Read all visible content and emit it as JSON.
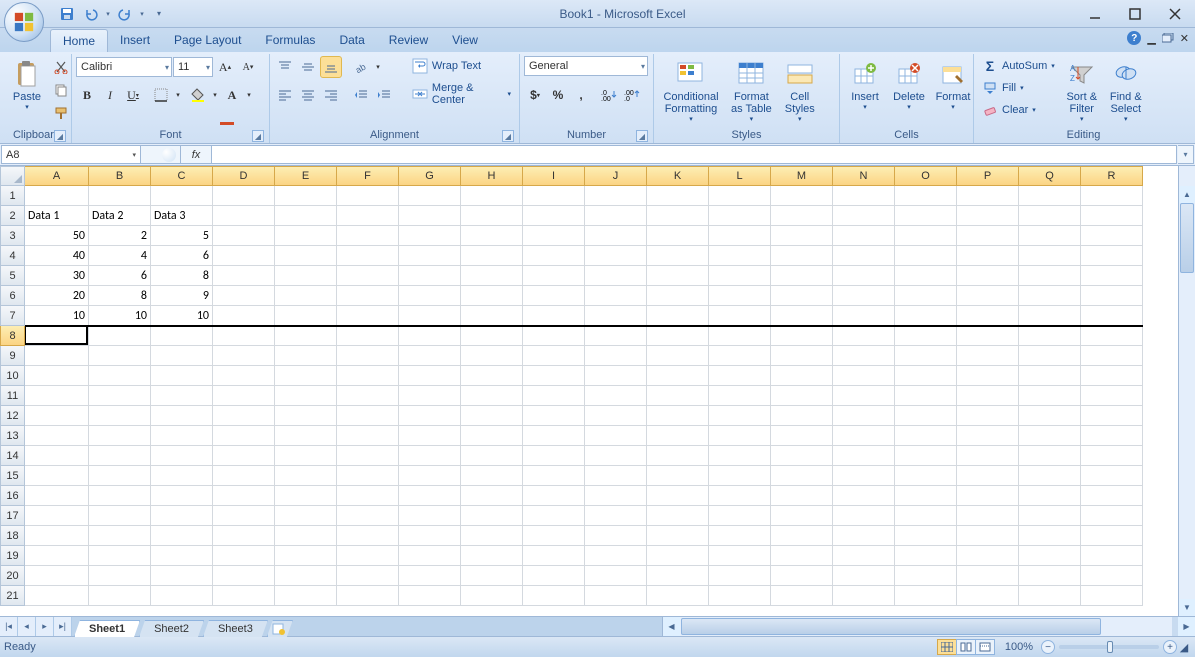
{
  "title": "Book1 - Microsoft Excel",
  "tabs": [
    "Home",
    "Insert",
    "Page Layout",
    "Formulas",
    "Data",
    "Review",
    "View"
  ],
  "active_tab": "Home",
  "ribbon": {
    "clipboard": {
      "label": "Clipboard",
      "paste": "Paste"
    },
    "font": {
      "label": "Font",
      "name": "Calibri",
      "size": "11"
    },
    "alignment": {
      "label": "Alignment",
      "wrap": "Wrap Text",
      "merge": "Merge & Center"
    },
    "number": {
      "label": "Number",
      "format": "General"
    },
    "styles": {
      "label": "Styles",
      "cond": "Conditional\nFormatting",
      "table": "Format\nas Table",
      "cell": "Cell\nStyles"
    },
    "cells": {
      "label": "Cells",
      "insert": "Insert",
      "delete": "Delete",
      "format": "Format"
    },
    "editing": {
      "label": "Editing",
      "autosum": "AutoSum",
      "fill": "Fill",
      "clear": "Clear",
      "sort": "Sort &\nFilter",
      "find": "Find &\nSelect"
    }
  },
  "namebox": "A8",
  "fx": "fx",
  "columns": [
    "A",
    "B",
    "C",
    "D",
    "E",
    "F",
    "G",
    "H",
    "I",
    "J",
    "K",
    "L",
    "M",
    "N",
    "O",
    "P",
    "Q",
    "R"
  ],
  "col_widths": {
    "default": 62,
    "first": 64
  },
  "rows_visible": 21,
  "highlighted_row": 8,
  "active_cell": {
    "col": 0,
    "row": 7
  },
  "cells": {
    "A2": "Data 1",
    "B2": "Data 2",
    "C2": "Data 3",
    "A3": "50",
    "B3": "2",
    "C3": "5",
    "A4": "40",
    "B4": "4",
    "C4": "6",
    "A5": "30",
    "B5": "6",
    "C5": "8",
    "A6": "20",
    "B6": "8",
    "C6": "9",
    "A7": "10",
    "B7": "10",
    "C7": "10"
  },
  "numeric_right": [
    "A3",
    "A4",
    "A5",
    "A6",
    "A7",
    "B3",
    "B4",
    "B5",
    "B6",
    "B7",
    "C3",
    "C4",
    "C5",
    "C6",
    "C7"
  ],
  "sheet_tabs": [
    "Sheet1",
    "Sheet2",
    "Sheet3"
  ],
  "active_sheet": "Sheet1",
  "status": "Ready",
  "zoom": "100%",
  "chart_data": {
    "type": "table",
    "columns": [
      "Data 1",
      "Data 2",
      "Data 3"
    ],
    "rows": [
      [
        50,
        2,
        5
      ],
      [
        40,
        4,
        6
      ],
      [
        30,
        6,
        8
      ],
      [
        20,
        8,
        9
      ],
      [
        10,
        10,
        10
      ]
    ]
  }
}
